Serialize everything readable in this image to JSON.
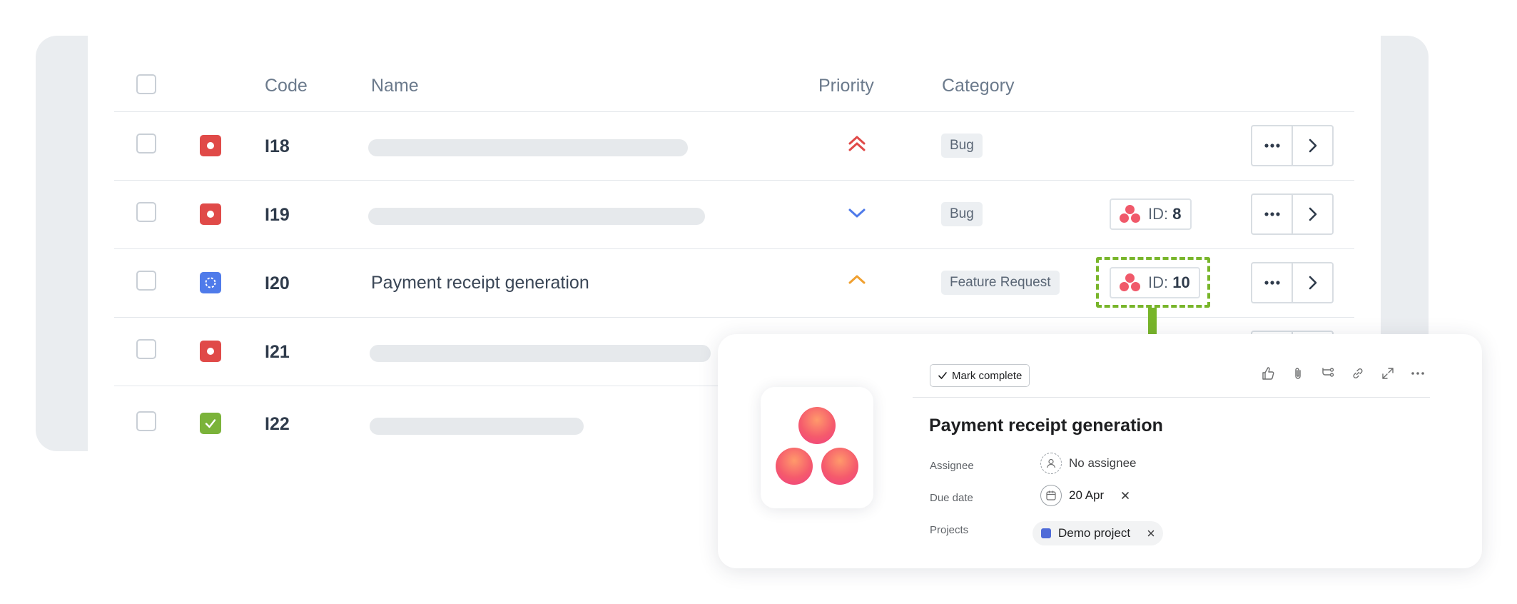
{
  "table": {
    "headers": {
      "code": "Code",
      "name": "Name",
      "priority": "Priority",
      "category": "Category"
    },
    "rows": [
      {
        "code": "I18",
        "status": "red",
        "name": "",
        "priority_icon": "double-chevron-up-icon",
        "category": "Bug",
        "id_prefix": "",
        "id_value": ""
      },
      {
        "code": "I19",
        "status": "red",
        "name": "",
        "priority_icon": "chevron-down-icon",
        "category": "Bug",
        "id_prefix": "ID:",
        "id_value": "8"
      },
      {
        "code": "I20",
        "status": "blue",
        "name": "Payment receipt generation",
        "priority_icon": "chevron-up-icon",
        "category": "Feature Request",
        "id_prefix": "ID:",
        "id_value": "10"
      },
      {
        "code": "I21",
        "status": "red",
        "name": ""
      },
      {
        "code": "I22",
        "status": "green",
        "name": ""
      }
    ]
  },
  "task_popup": {
    "mark_complete_label": "Mark complete",
    "title": "Payment receipt generation",
    "assignee_label": "Assignee",
    "assignee_value": "No assignee",
    "due_date_label": "Due date",
    "due_date_value": "20 Apr",
    "projects_label": "Projects",
    "project_name": "Demo project",
    "toolbar_icons": [
      "thumbs-up-icon",
      "paperclip-icon",
      "subtask-icon",
      "link-icon",
      "expand-icon",
      "more-icon"
    ]
  },
  "colors": {
    "accent_green": "#78b52a",
    "status_red": "#e04a48",
    "status_blue": "#4f7bea",
    "status_green": "#7bb33a",
    "priority_high": "#e04a48",
    "priority_low": "#4f7bea",
    "priority_medium": "#f0a030",
    "asana_coral": "#f0596a",
    "project_color": "#4f6bd8"
  }
}
